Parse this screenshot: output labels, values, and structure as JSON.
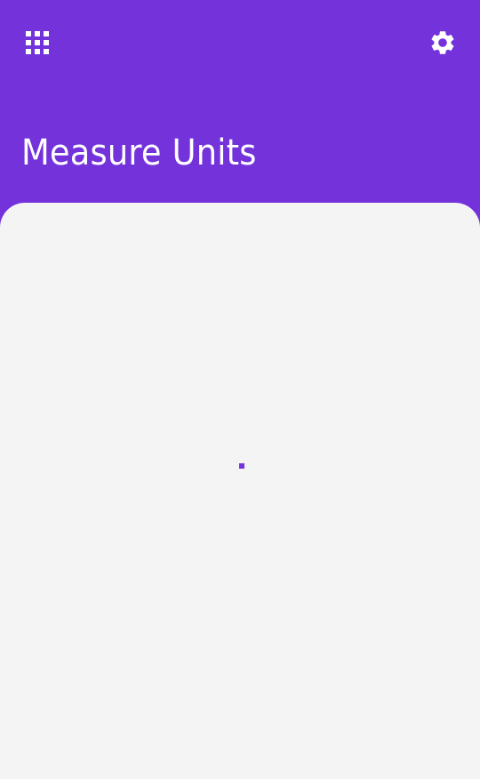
{
  "app": {
    "title": "Measure Units"
  },
  "toolbar": {
    "apps_icon": "apps-grid-icon",
    "settings_icon": "gear-icon"
  },
  "theme": {
    "primary": "#7432db",
    "surface": "#f4f4f4",
    "on_primary": "#ffffff"
  },
  "content": {
    "state": "loading"
  }
}
